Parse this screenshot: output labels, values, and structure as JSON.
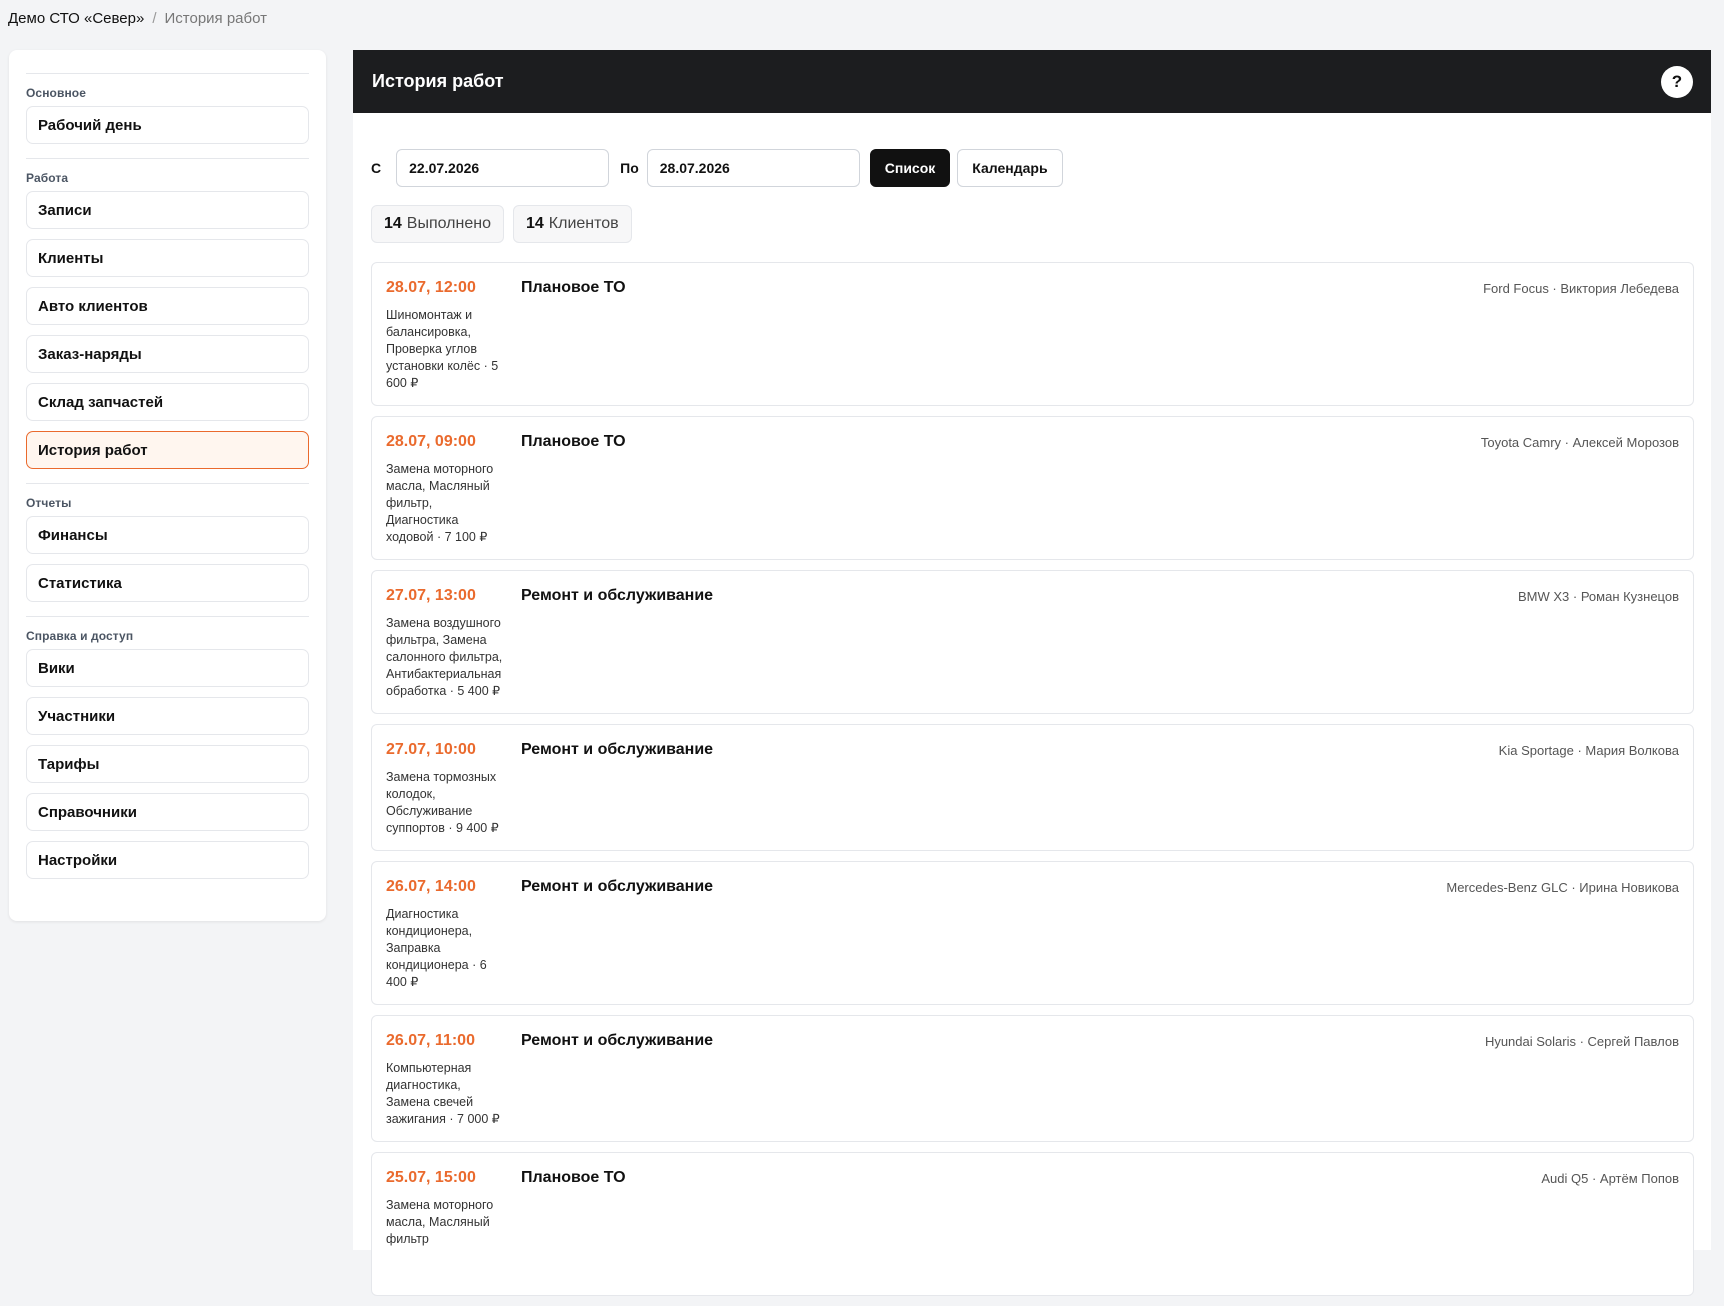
{
  "breadcrumb": {
    "org": "Демо СТО «Север»",
    "separator": "/",
    "current": "История работ"
  },
  "sidebar": {
    "groups": [
      {
        "title": "Основное",
        "items": [
          "Рабочий день"
        ]
      },
      {
        "title": "Работа",
        "items": [
          "Записи",
          "Клиенты",
          "Авто клиентов",
          "Заказ-наряды",
          "Склад запчастей",
          "История работ"
        ]
      },
      {
        "title": "Отчеты",
        "items": [
          "Финансы",
          "Статистика"
        ]
      },
      {
        "title": "Справка и доступ",
        "items": [
          "Вики",
          "Участники",
          "Тарифы",
          "Справочники",
          "Настройки"
        ]
      }
    ],
    "active": "История работ"
  },
  "header": {
    "title": "История работ",
    "help": "?"
  },
  "filters": {
    "from_label": "С",
    "from_value": "22.07.2026",
    "to_label": "По",
    "to_value": "28.07.2026",
    "list_button": "Список",
    "calendar_button": "Календарь"
  },
  "stats": [
    {
      "count": "14",
      "label": "Выполнено"
    },
    {
      "count": "14",
      "label": "Клиентов"
    }
  ],
  "records": [
    {
      "time": "28.07, 12:00",
      "title": "Плановое ТО",
      "desc": "Шиномонтаж и балансировка, Проверка углов установки колёс · 5 600 ₽",
      "meta": "Ford Focus · Виктория Лебедева"
    },
    {
      "time": "28.07, 09:00",
      "title": "Плановое ТО",
      "desc": "Замена моторного масла, Масляный фильтр, Диагностика ходовой · 7 100 ₽",
      "meta": "Toyota Camry · Алексей Морозов"
    },
    {
      "time": "27.07, 13:00",
      "title": "Ремонт и обслуживание",
      "desc": "Замена воздушного фильтра, Замена салонного фильтра, Антибактериальная обработка · 5 400 ₽",
      "meta": "BMW X3 · Роман Кузнецов"
    },
    {
      "time": "27.07, 10:00",
      "title": "Ремонт и обслуживание",
      "desc": "Замена тормозных колодок, Обслуживание суппортов · 9 400 ₽",
      "meta": "Kia Sportage · Мария Волкова"
    },
    {
      "time": "26.07, 14:00",
      "title": "Ремонт и обслуживание",
      "desc": "Диагностика кондиционера, Заправка кондиционера · 6 400 ₽",
      "meta": "Mercedes-Benz GLC · Ирина Новикова"
    },
    {
      "time": "26.07, 11:00",
      "title": "Ремонт и обслуживание",
      "desc": "Компьютерная диагностика, Замена свечей зажигания · 7 000 ₽",
      "meta": "Hyundai Solaris · Сергей Павлов"
    },
    {
      "time": "25.07, 15:00",
      "title": "Плановое ТО",
      "desc": "Замена моторного масла, Масляный фильтр",
      "meta": "Audi Q5 · Артём Попов"
    }
  ]
}
